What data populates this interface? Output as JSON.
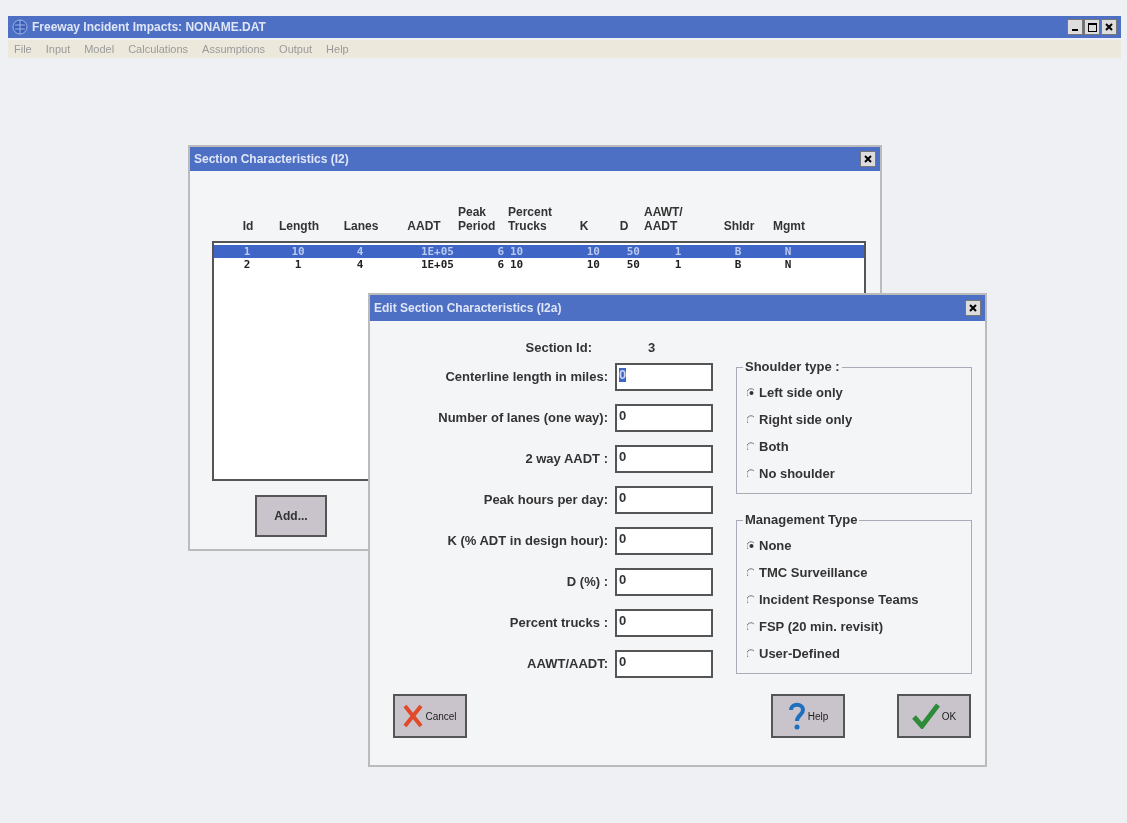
{
  "window": {
    "title": "Freeway Incident Impacts: NONAME.DAT"
  },
  "menu": [
    "File",
    "Input",
    "Model",
    "Calculations",
    "Assumptions",
    "Output",
    "Help"
  ],
  "section_dialog": {
    "title": "Section Characteristics (I2)",
    "columns": [
      "Id",
      "Length",
      "Lanes",
      "AADT",
      "Peak\nPeriod",
      "Percent\nTrucks",
      "K",
      "D",
      "AAWT/\nAADT",
      "Shldr",
      "Mgmt"
    ],
    "rows": [
      {
        "cells": [
          "1",
          "10",
          "4",
          "1E+05",
          "6",
          "10",
          "10",
          "50",
          "1",
          "B",
          "N"
        ],
        "selected": true
      },
      {
        "cells": [
          "2",
          "1",
          "4",
          "1E+05",
          "6",
          "10",
          "10",
          "50",
          "1",
          "B",
          "N"
        ],
        "selected": false
      }
    ],
    "buttons": [
      "Add..."
    ]
  },
  "edit_dialog": {
    "title": "Edit Section Characteristics (I2a)",
    "section_id": {
      "label": "Section Id:",
      "value": "3"
    },
    "fields": [
      {
        "label": "Centerline length in miles:",
        "value": "0",
        "selected": true
      },
      {
        "label": "Number of lanes (one way):",
        "value": "0",
        "selected": false
      },
      {
        "label": "2 way AADT :",
        "value": "0",
        "selected": false
      },
      {
        "label": "Peak hours per day:",
        "value": "0",
        "selected": false
      },
      {
        "label": "K (% ADT in design hour):",
        "value": "0",
        "selected": false
      },
      {
        "label": "D (%) :",
        "value": "0",
        "selected": false
      },
      {
        "label": "Percent trucks :",
        "value": "0",
        "selected": false
      },
      {
        "label": "AAWT/AADT:",
        "value": "0",
        "selected": false
      }
    ],
    "groups": [
      {
        "title": "Shoulder type :",
        "options": [
          {
            "label": "Left side only",
            "selected": true
          },
          {
            "label": "Right side only",
            "selected": false
          },
          {
            "label": "Both",
            "selected": false
          },
          {
            "label": "No shoulder",
            "selected": false
          }
        ]
      },
      {
        "title": "Management Type",
        "options": [
          {
            "label": "None",
            "selected": true
          },
          {
            "label": "TMC Surveillance",
            "selected": false
          },
          {
            "label": "Incident Response Teams",
            "selected": false
          },
          {
            "label": "FSP (20 min. revisit)",
            "selected": false
          },
          {
            "label": "User-Defined",
            "selected": false
          }
        ]
      }
    ],
    "buttons": [
      {
        "kind": "cancel",
        "label": "Cancel"
      },
      {
        "kind": "help",
        "label": "Help"
      },
      {
        "kind": "ok",
        "label": "OK"
      }
    ]
  }
}
